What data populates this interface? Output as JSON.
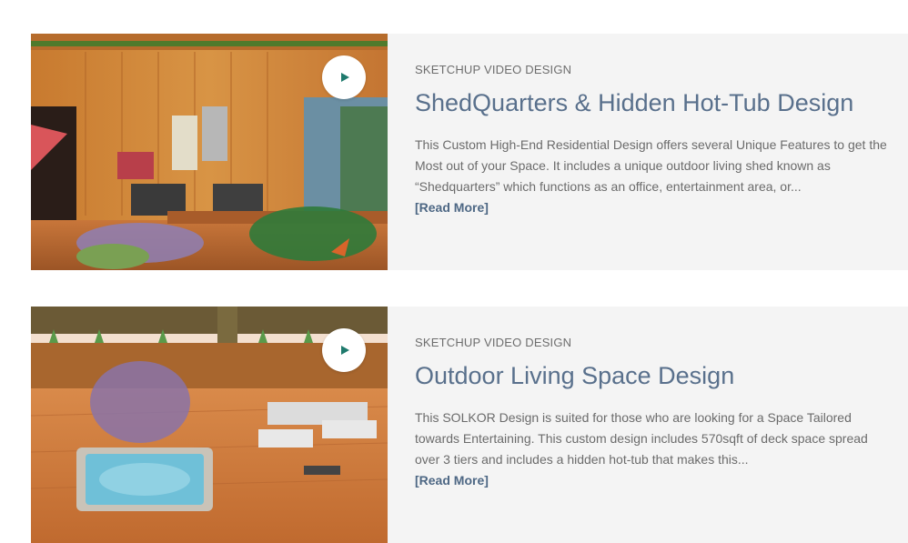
{
  "posts": [
    {
      "category": "SKETCHUP VIDEO DESIGN",
      "title": "ShedQuarters & Hidden Hot-Tub Design",
      "excerpt": "This Custom High-End Residential Design offers several Unique Features to get the Most out of your Space. It includes a unique outdoor living shed known as “Shedquarters” which functions as an office, entertainment area, or...",
      "read_more": "[Read More]",
      "thumbnail_icon": "play-icon"
    },
    {
      "category": "SKETCHUP VIDEO DESIGN",
      "title": "Outdoor Living Space Design",
      "excerpt": "This SOLKOR Design is suited for those who are looking for a Space Tailored towards Entertaining. This custom design includes 570sqft of deck space spread over 3 tiers and includes a hidden hot-tub that makes this...",
      "read_more": "[Read More]",
      "thumbnail_icon": "play-icon"
    }
  ],
  "colors": {
    "title": "#59708c",
    "category": "#6d6d6d",
    "excerpt": "#6b6b6b",
    "read_more": "#4d6784",
    "card_bg": "#f4f4f4",
    "play_icon": "#1f7a6d"
  }
}
